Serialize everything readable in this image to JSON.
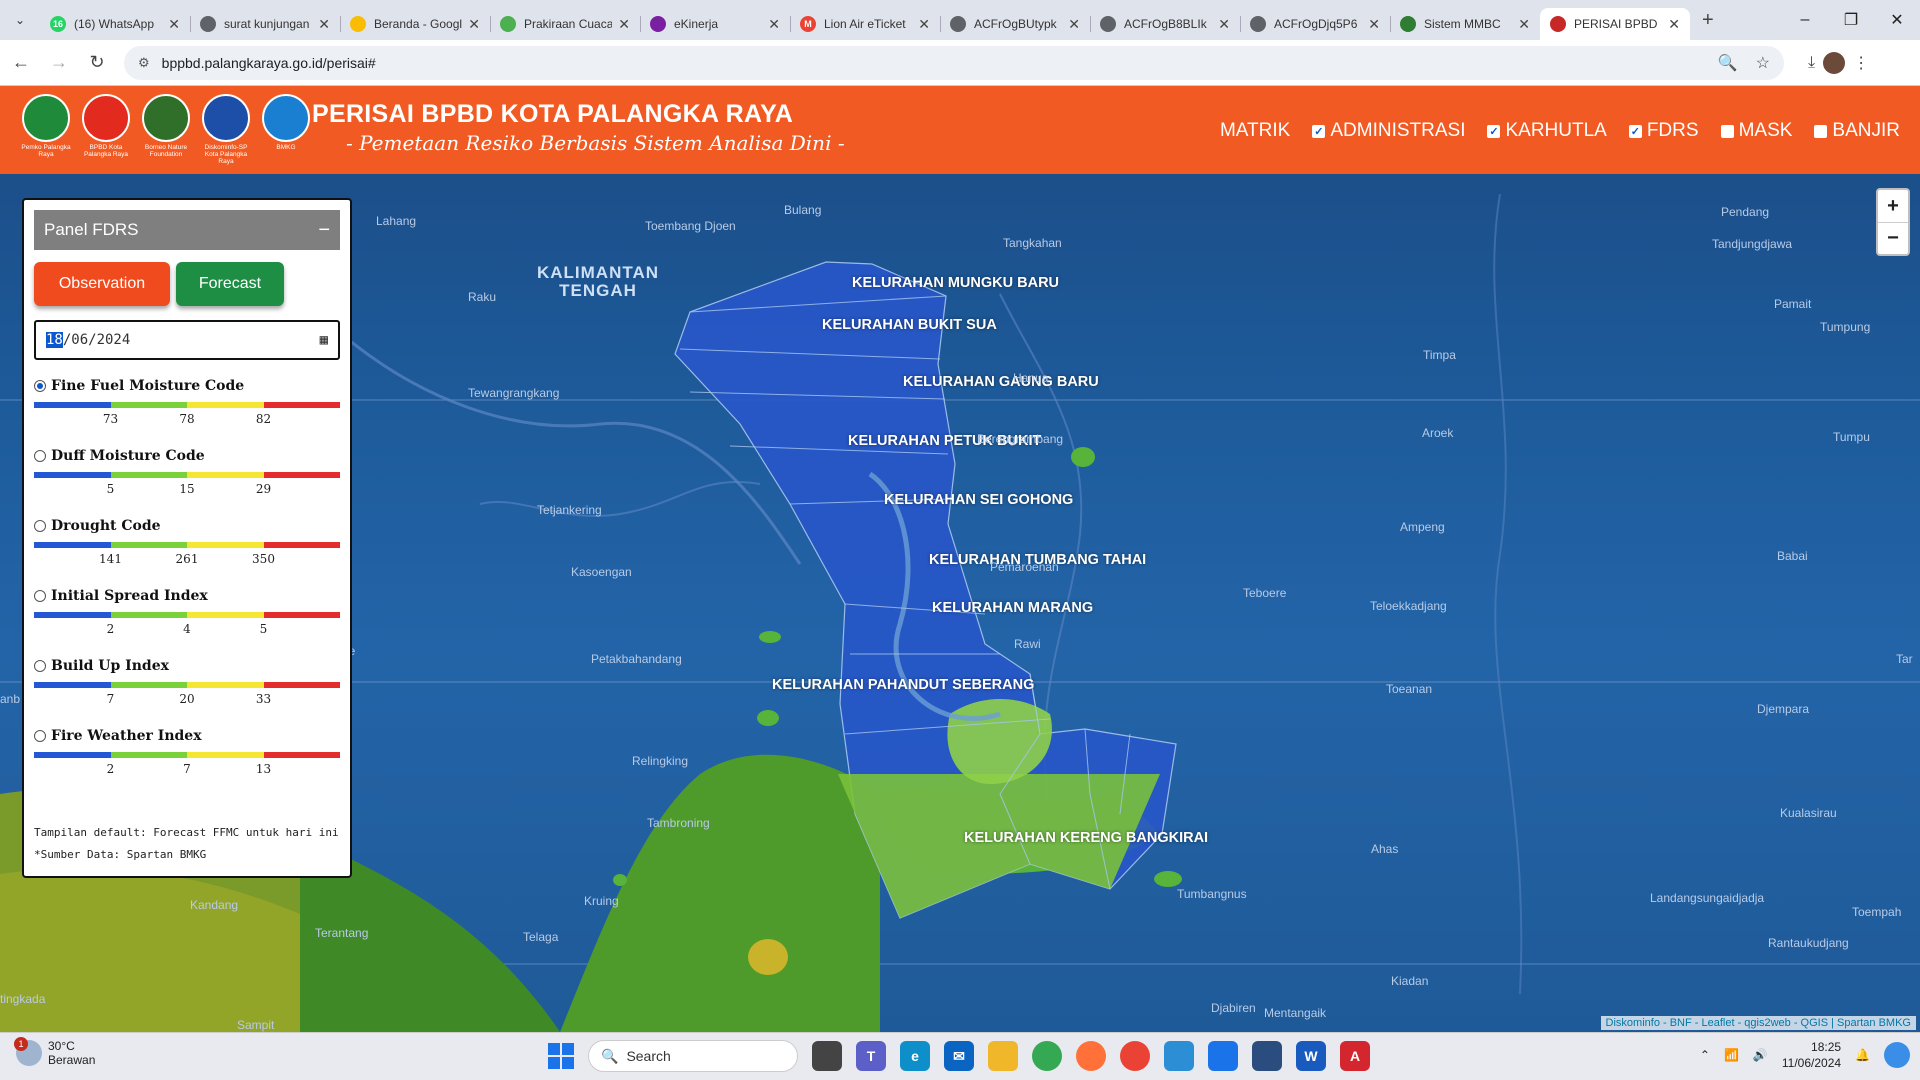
{
  "browser": {
    "tabs": [
      {
        "title": "(16) WhatsApp",
        "favicon_color": "#25d366",
        "favicon_text": "16"
      },
      {
        "title": "surat kunjungan",
        "favicon_color": "#5f6368",
        "favicon_text": ""
      },
      {
        "title": "Beranda - Google",
        "favicon_color": "#fbbc04",
        "favicon_text": ""
      },
      {
        "title": "Prakiraan Cuaca",
        "favicon_color": "#4caf50",
        "favicon_text": ""
      },
      {
        "title": "eKinerja",
        "favicon_color": "#7b1fa2",
        "favicon_text": ""
      },
      {
        "title": "Lion Air eTicket",
        "favicon_color": "#ea4335",
        "favicon_text": "M"
      },
      {
        "title": "ACFrOgBUtypk",
        "favicon_color": "#5f6368",
        "favicon_text": ""
      },
      {
        "title": "ACFrOgB8BLIk",
        "favicon_color": "#5f6368",
        "favicon_text": ""
      },
      {
        "title": "ACFrOgDjq5P6",
        "favicon_color": "#5f6368",
        "favicon_text": ""
      },
      {
        "title": "Sistem MMBC",
        "favicon_color": "#2e7d32",
        "favicon_text": ""
      },
      {
        "title": "PERISAI BPBD",
        "favicon_color": "#c62828",
        "favicon_text": "",
        "active": true
      }
    ],
    "url": "bppbd.palangkaraya.go.id/perisai#"
  },
  "header": {
    "title": "PERISAI BPBD KOTA PALANGKA RAYA",
    "subtitle": "- Pemetaan Resiko Berbasis Sistem Analisa Dini -",
    "logos": [
      {
        "caption": "Pemko Palangka Raya",
        "color": "#1f8a3a"
      },
      {
        "caption": "BPBD Kota Palangka Raya",
        "color": "#e32a1f"
      },
      {
        "caption": "Borneo Nature Foundation",
        "color": "#2f6f2a"
      },
      {
        "caption": "Diskominfo-SP Kota Palangka Raya",
        "color": "#1e4fa8"
      },
      {
        "caption": "BMKG",
        "color": "#1a7fd0"
      }
    ],
    "nav": [
      {
        "label": "MATRIK",
        "checkbox": false,
        "checked": false
      },
      {
        "label": "ADMINISTRASI",
        "checkbox": true,
        "checked": true
      },
      {
        "label": "KARHUTLA",
        "checkbox": true,
        "checked": true
      },
      {
        "label": "FDRS",
        "checkbox": true,
        "checked": true
      },
      {
        "label": "MASK",
        "checkbox": true,
        "checked": false
      },
      {
        "label": "BANJIR",
        "checkbox": true,
        "checked": false
      }
    ]
  },
  "panel": {
    "title": "Panel FDRS",
    "minimize": "−",
    "observation_label": "Observation",
    "forecast_label": "Forecast",
    "date_day": "18",
    "date_rest": "/06/2024",
    "indices": [
      {
        "name": "Fine Fuel Moisture Code",
        "selected": true,
        "ticks": [
          "73",
          "78",
          "82"
        ]
      },
      {
        "name": "Duff Moisture Code",
        "selected": false,
        "ticks": [
          "5",
          "15",
          "29"
        ]
      },
      {
        "name": "Drought Code",
        "selected": false,
        "ticks": [
          "141",
          "261",
          "350"
        ]
      },
      {
        "name": "Initial Spread Index",
        "selected": false,
        "ticks": [
          "2",
          "4",
          "5"
        ]
      },
      {
        "name": "Build Up Index",
        "selected": false,
        "ticks": [
          "7",
          "20",
          "33"
        ]
      },
      {
        "name": "Fire Weather Index",
        "selected": false,
        "ticks": [
          "2",
          "7",
          "13"
        ]
      }
    ],
    "scale_colors": [
      "#2457d6",
      "#7ad13a",
      "#f5e634",
      "#e32d2d"
    ],
    "note_1": "Tampilan default: Forecast FFMC untuk hari ini",
    "note_2": "*Sumber Data: Spartan BMKG"
  },
  "map": {
    "region_label": "KALIMANTAN TENGAH",
    "kelurahan": [
      "KELURAHAN MUNGKU BARU",
      "KELURAHAN BUKIT SUA",
      "KELURAHAN GAUNG BARU",
      "KELURAHAN PETUK BUKIT",
      "KELURAHAN SEI GOHONG",
      "KELURAHAN TUMBANG TAHAI",
      "KELURAHAN MARANG",
      "KELURAHAN PAHANDUT SEBERANG",
      "KELURAHAN KERENG BANGKIRAI"
    ],
    "places": [
      "Lahang",
      "Bulang",
      "Toembang Djoen",
      "Tangkahan",
      "Pendang",
      "Tandjungdjawa",
      "Raku",
      "Hanua",
      "Pamait",
      "Tumpung",
      "Timpa",
      "Tewangrangkang",
      "Aroek",
      "Berengrambang",
      "Tumpu",
      "Tetjankering",
      "Ampeng",
      "Pemaroenan",
      "Kasoengan",
      "Babai",
      "Teboere",
      "Teloekkadjang",
      "Rawi",
      "Petakbahandang",
      "Toeanan",
      "Tar",
      "Djempara",
      "Relingking",
      "Tambroning",
      "Kualasirau",
      "Ahas",
      "Kandang",
      "Kruing",
      "Tumbangnus",
      "Landangsungaidjadja",
      "Toempah",
      "Terantang",
      "Telaga",
      "Rantaukudjang",
      "Kiadan",
      "tingkada",
      "Djabiren",
      "Mentangaik",
      "Sampit",
      "anb",
      "be"
    ],
    "zoom_in": "+",
    "zoom_out": "−",
    "attribution": "Diskominfo - BNF - Leaflet - qgis2web - QGIS | Spartan BMKG"
  },
  "taskbar": {
    "temperature": "30°C",
    "condition": "Berawan",
    "weather_badge": "1",
    "search_placeholder": "Search",
    "time": "18:25",
    "date": "11/06/2024"
  }
}
